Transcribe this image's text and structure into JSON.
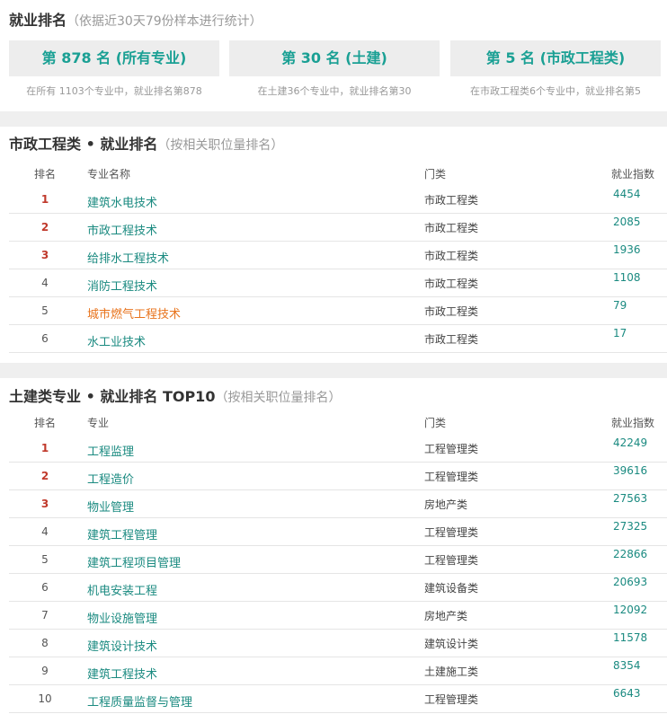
{
  "header": {
    "title": "就业排名",
    "subtitle": "（依据近30天79份样本进行统计）"
  },
  "cards": [
    {
      "label": "第 878 名 (所有专业)",
      "desc": "在所有 1103个专业中，就业排名第878"
    },
    {
      "label": "第 30 名 (土建)",
      "desc": "在土建36个专业中，就业排名第30"
    },
    {
      "label": "第 5 名 (市政工程类)",
      "desc": "在市政工程类6个专业中，就业排名第5"
    }
  ],
  "section1": {
    "title": "市政工程类 • 就业排名",
    "subtitle": "（按相关职位量排名）",
    "col_rank": "排名",
    "col_name": "专业名称",
    "col_cat": "门类",
    "col_idx": "就业指数",
    "rows": [
      {
        "rank": "1",
        "name": "建筑水电技术",
        "cat": "市政工程类",
        "idx": "4454"
      },
      {
        "rank": "2",
        "name": "市政工程技术",
        "cat": "市政工程类",
        "idx": "2085"
      },
      {
        "rank": "3",
        "name": "给排水工程技术",
        "cat": "市政工程类",
        "idx": "1936"
      },
      {
        "rank": "4",
        "name": "消防工程技术",
        "cat": "市政工程类",
        "idx": "1108"
      },
      {
        "rank": "5",
        "name": "城市燃气工程技术",
        "cat": "市政工程类",
        "idx": "79"
      },
      {
        "rank": "6",
        "name": "水工业技术",
        "cat": "市政工程类",
        "idx": "17"
      }
    ]
  },
  "section2": {
    "title": "土建类专业 • 就业排名 TOP10",
    "subtitle": "（按相关职位量排名）",
    "col_rank": "排名",
    "col_name": "专业",
    "col_cat": "门类",
    "col_idx": "就业指数",
    "rows": [
      {
        "rank": "1",
        "name": "工程监理",
        "cat": "工程管理类",
        "idx": "42249"
      },
      {
        "rank": "2",
        "name": "工程造价",
        "cat": "工程管理类",
        "idx": "39616"
      },
      {
        "rank": "3",
        "name": "物业管理",
        "cat": "房地产类",
        "idx": "27563"
      },
      {
        "rank": "4",
        "name": "建筑工程管理",
        "cat": "工程管理类",
        "idx": "27325"
      },
      {
        "rank": "5",
        "name": "建筑工程项目管理",
        "cat": "工程管理类",
        "idx": "22866"
      },
      {
        "rank": "6",
        "name": "机电安装工程",
        "cat": "建筑设备类",
        "idx": "20693"
      },
      {
        "rank": "7",
        "name": "物业设施管理",
        "cat": "房地产类",
        "idx": "12092"
      },
      {
        "rank": "8",
        "name": "建筑设计技术",
        "cat": "建筑设计类",
        "idx": "11578"
      },
      {
        "rank": "9",
        "name": "建筑工程技术",
        "cat": "土建施工类",
        "idx": "8354"
      },
      {
        "rank": "10",
        "name": "工程质量监督与管理",
        "cat": "工程管理类",
        "idx": "6643"
      }
    ]
  },
  "colors": {
    "accent": "#1aa094",
    "link": "#1a8a80",
    "rank_top": "#c0392b",
    "highlight": "#e8731c",
    "card_bg": "#ededed"
  }
}
